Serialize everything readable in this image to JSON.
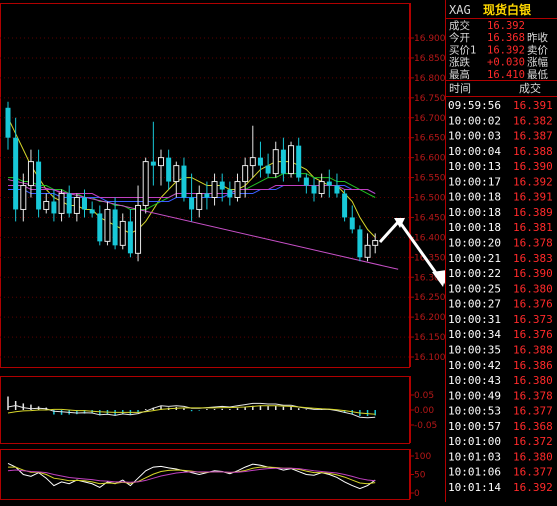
{
  "colors": {
    "background": "#000000",
    "frame": "#b00000",
    "grid": "#5a0000",
    "axis_text": "#b41818",
    "up": "#e6e6e6",
    "down": "#18c8d8",
    "ma_yellow": "#d6d62a",
    "ma_green": "#22c022",
    "ma_blue": "#3a5cff",
    "ma_magenta": "#c040c0",
    "trend": "#c850c8",
    "price_red": "#ff2a2a",
    "time_text": "#ffffff",
    "label_text": "#d8d8d8",
    "symbol_yellow": "#ffd800"
  },
  "header": {
    "symbol": "XAG",
    "name": "现货白银"
  },
  "quote": [
    {
      "label": "成交",
      "value": "16.392",
      "tail": ""
    },
    {
      "label": "今开",
      "value": "16.368",
      "tail": "昨收"
    },
    {
      "label": "买价1",
      "value": "16.392",
      "tail": "卖价"
    },
    {
      "label": "涨跌",
      "value": "+0.030",
      "tail": "涨幅"
    },
    {
      "label": "最高",
      "value": "16.410",
      "tail": "最低"
    }
  ],
  "ticks_header": {
    "time": "时间",
    "price": "成交"
  },
  "ticks": [
    {
      "time": "09:59:56",
      "price": "16.391"
    },
    {
      "time": "10:00:02",
      "price": "16.382"
    },
    {
      "time": "10:00:03",
      "price": "16.387"
    },
    {
      "time": "10:00:04",
      "price": "16.388"
    },
    {
      "time": "10:00:13",
      "price": "16.390"
    },
    {
      "time": "10:00:17",
      "price": "16.392"
    },
    {
      "time": "10:00:18",
      "price": "16.391"
    },
    {
      "time": "10:00:18",
      "price": "16.389"
    },
    {
      "time": "10:00:18",
      "price": "16.381"
    },
    {
      "time": "10:00:20",
      "price": "16.378"
    },
    {
      "time": "10:00:21",
      "price": "16.383"
    },
    {
      "time": "10:00:22",
      "price": "16.390"
    },
    {
      "time": "10:00:25",
      "price": "16.380"
    },
    {
      "time": "10:00:27",
      "price": "16.376"
    },
    {
      "time": "10:00:31",
      "price": "16.373"
    },
    {
      "time": "10:00:34",
      "price": "16.376"
    },
    {
      "time": "10:00:35",
      "price": "16.388"
    },
    {
      "time": "10:00:42",
      "price": "16.386"
    },
    {
      "time": "10:00:43",
      "price": "16.380"
    },
    {
      "time": "10:00:49",
      "price": "16.378"
    },
    {
      "time": "10:00:53",
      "price": "16.377"
    },
    {
      "time": "10:00:57",
      "price": "16.368"
    },
    {
      "time": "10:01:00",
      "price": "16.372"
    },
    {
      "time": "10:01:03",
      "price": "16.380"
    },
    {
      "time": "10:01:06",
      "price": "16.377"
    },
    {
      "time": "10:01:14",
      "price": "16.392"
    }
  ],
  "chart_data": [
    {
      "type": "candlestick",
      "ylim": [
        16.1,
        16.9
      ],
      "y_ticks": [
        "16.900",
        "16.850",
        "16.800",
        "16.750",
        "16.700",
        "16.650",
        "16.600",
        "16.550",
        "16.500",
        "16.450",
        "16.400",
        "16.350",
        "16.300",
        "16.250",
        "16.200",
        "16.150",
        "16.100"
      ],
      "grid": true,
      "candles": [
        {
          "o": 16.725,
          "h": 16.74,
          "l": 16.62,
          "c": 16.65
        },
        {
          "o": 16.65,
          "h": 16.7,
          "l": 16.44,
          "c": 16.47
        },
        {
          "o": 16.47,
          "h": 16.56,
          "l": 16.44,
          "c": 16.53
        },
        {
          "o": 16.53,
          "h": 16.62,
          "l": 16.5,
          "c": 16.59
        },
        {
          "o": 16.59,
          "h": 16.62,
          "l": 16.45,
          "c": 16.47
        },
        {
          "o": 16.47,
          "h": 16.51,
          "l": 16.46,
          "c": 16.49
        },
        {
          "o": 16.49,
          "h": 16.52,
          "l": 16.44,
          "c": 16.46
        },
        {
          "o": 16.46,
          "h": 16.52,
          "l": 16.44,
          "c": 16.51
        },
        {
          "o": 16.51,
          "h": 16.53,
          "l": 16.45,
          "c": 16.46
        },
        {
          "o": 16.46,
          "h": 16.51,
          "l": 16.44,
          "c": 16.5
        },
        {
          "o": 16.5,
          "h": 16.52,
          "l": 16.45,
          "c": 16.47
        },
        {
          "o": 16.47,
          "h": 16.49,
          "l": 16.45,
          "c": 16.46
        },
        {
          "o": 16.46,
          "h": 16.48,
          "l": 16.38,
          "c": 16.39
        },
        {
          "o": 16.39,
          "h": 16.49,
          "l": 16.38,
          "c": 16.47
        },
        {
          "o": 16.47,
          "h": 16.5,
          "l": 16.37,
          "c": 16.38
        },
        {
          "o": 16.38,
          "h": 16.46,
          "l": 16.37,
          "c": 16.44
        },
        {
          "o": 16.44,
          "h": 16.47,
          "l": 16.35,
          "c": 16.36
        },
        {
          "o": 16.36,
          "h": 16.53,
          "l": 16.34,
          "c": 16.48
        },
        {
          "o": 16.48,
          "h": 16.6,
          "l": 16.46,
          "c": 16.59
        },
        {
          "o": 16.59,
          "h": 16.69,
          "l": 16.53,
          "c": 16.58
        },
        {
          "o": 16.58,
          "h": 16.62,
          "l": 16.53,
          "c": 16.6
        },
        {
          "o": 16.6,
          "h": 16.62,
          "l": 16.52,
          "c": 16.54
        },
        {
          "o": 16.54,
          "h": 16.59,
          "l": 16.5,
          "c": 16.58
        },
        {
          "o": 16.58,
          "h": 16.6,
          "l": 16.49,
          "c": 16.5
        },
        {
          "o": 16.5,
          "h": 16.56,
          "l": 16.44,
          "c": 16.47
        },
        {
          "o": 16.47,
          "h": 16.53,
          "l": 16.45,
          "c": 16.51
        },
        {
          "o": 16.51,
          "h": 16.54,
          "l": 16.47,
          "c": 16.5
        },
        {
          "o": 16.5,
          "h": 16.56,
          "l": 16.48,
          "c": 16.54
        },
        {
          "o": 16.54,
          "h": 16.56,
          "l": 16.49,
          "c": 16.52
        },
        {
          "o": 16.52,
          "h": 16.54,
          "l": 16.48,
          "c": 16.5
        },
        {
          "o": 16.5,
          "h": 16.56,
          "l": 16.49,
          "c": 16.54
        },
        {
          "o": 16.54,
          "h": 16.6,
          "l": 16.5,
          "c": 16.58
        },
        {
          "o": 16.58,
          "h": 16.68,
          "l": 16.55,
          "c": 16.6
        },
        {
          "o": 16.6,
          "h": 16.64,
          "l": 16.55,
          "c": 16.58
        },
        {
          "o": 16.58,
          "h": 16.61,
          "l": 16.55,
          "c": 16.56
        },
        {
          "o": 16.56,
          "h": 16.64,
          "l": 16.55,
          "c": 16.62
        },
        {
          "o": 16.62,
          "h": 16.65,
          "l": 16.54,
          "c": 16.56
        },
        {
          "o": 16.56,
          "h": 16.64,
          "l": 16.55,
          "c": 16.63
        },
        {
          "o": 16.63,
          "h": 16.65,
          "l": 16.54,
          "c": 16.55
        },
        {
          "o": 16.55,
          "h": 16.56,
          "l": 16.51,
          "c": 16.53
        },
        {
          "o": 16.53,
          "h": 16.55,
          "l": 16.49,
          "c": 16.51
        },
        {
          "o": 16.51,
          "h": 16.56,
          "l": 16.5,
          "c": 16.54
        },
        {
          "o": 16.54,
          "h": 16.57,
          "l": 16.5,
          "c": 16.53
        },
        {
          "o": 16.53,
          "h": 16.56,
          "l": 16.5,
          "c": 16.51
        },
        {
          "o": 16.51,
          "h": 16.52,
          "l": 16.44,
          "c": 16.45
        },
        {
          "o": 16.45,
          "h": 16.48,
          "l": 16.41,
          "c": 16.42
        },
        {
          "o": 16.42,
          "h": 16.43,
          "l": 16.34,
          "c": 16.35
        },
        {
          "o": 16.35,
          "h": 16.41,
          "l": 16.34,
          "c": 16.38
        },
        {
          "o": 16.38,
          "h": 16.41,
          "l": 16.36,
          "c": 16.392
        }
      ],
      "series": [
        {
          "color": "#d6d62a",
          "values": [
            16.7,
            16.66,
            16.62,
            16.58,
            16.55,
            16.52,
            16.5,
            16.49,
            16.48,
            16.48,
            16.47,
            16.47,
            16.45,
            16.44,
            16.43,
            16.42,
            16.41,
            16.42,
            16.44,
            16.47,
            16.5,
            16.52,
            16.54,
            16.55,
            16.55,
            16.54,
            16.53,
            16.53,
            16.53,
            16.52,
            16.52,
            16.53,
            16.55,
            16.57,
            16.58,
            16.59,
            16.59,
            16.59,
            16.58,
            16.57,
            16.55,
            16.54,
            16.53,
            16.53,
            16.51,
            16.49,
            16.45,
            16.42,
            16.4
          ]
        },
        {
          "color": "#22c022",
          "values": [
            16.55,
            16.55,
            16.54,
            16.54,
            16.53,
            16.53,
            16.52,
            16.52,
            16.51,
            16.51,
            16.5,
            16.5,
            16.49,
            16.49,
            16.48,
            16.48,
            16.47,
            16.47,
            16.47,
            16.48,
            16.49,
            16.5,
            16.51,
            16.51,
            16.51,
            16.51,
            16.51,
            16.51,
            16.51,
            16.51,
            16.52,
            16.52,
            16.53,
            16.54,
            16.55,
            16.55,
            16.56,
            16.56,
            16.56,
            16.56,
            16.55,
            16.55,
            16.55,
            16.54,
            16.54,
            16.53,
            16.52,
            16.51,
            16.5
          ]
        },
        {
          "color": "#3a5cff",
          "values": [
            16.52,
            16.52,
            16.52,
            16.51,
            16.51,
            16.51,
            16.51,
            16.5,
            16.5,
            16.5,
            16.5,
            16.5,
            16.5,
            16.49,
            16.49,
            16.49,
            16.49,
            16.49,
            16.49,
            16.49,
            16.49,
            16.49,
            16.5,
            16.5,
            16.5,
            16.5,
            16.5,
            16.5,
            16.5,
            16.51,
            16.51,
            16.51,
            16.51,
            16.52,
            16.52,
            16.52,
            16.53,
            16.53,
            16.53,
            16.53,
            16.53,
            16.53,
            16.53,
            16.53,
            16.53,
            16.52,
            16.52,
            16.52,
            16.51
          ]
        },
        {
          "color": "#c040c0",
          "values": [
            16.53,
            16.53,
            16.53,
            16.52,
            16.52,
            16.52,
            16.52,
            16.51,
            16.51,
            16.51,
            16.51,
            16.51,
            16.5,
            16.5,
            16.5,
            16.5,
            16.5,
            16.5,
            16.5,
            16.5,
            16.5,
            16.5,
            16.51,
            16.51,
            16.51,
            16.51,
            16.51,
            16.51,
            16.51,
            16.51,
            16.52,
            16.52,
            16.52,
            16.52,
            16.52,
            16.53,
            16.53,
            16.53,
            16.53,
            16.53,
            16.53,
            16.53,
            16.53,
            16.53,
            16.52,
            16.52,
            16.52,
            16.52,
            16.51
          ]
        }
      ],
      "trendline": {
        "from_index": 0,
        "from_value": 16.545,
        "to_index": 51,
        "to_value": 16.32
      }
    },
    {
      "type": "bar",
      "ylim": [
        -0.07,
        0.07
      ],
      "y_ticks": [
        "0.05",
        "0.00",
        "-0.05"
      ],
      "values": [
        0.045,
        0.03,
        0.022,
        0.018,
        0.012,
        0.008,
        -0.015,
        -0.016,
        -0.015,
        -0.014,
        -0.012,
        -0.01,
        -0.018,
        -0.015,
        -0.019,
        -0.013,
        -0.017,
        -0.01,
        0.003,
        0.008,
        0.012,
        0.008,
        0.01,
        0.006,
        -0.004,
        -0.002,
        0.003,
        0.003,
        0.004,
        0.003,
        0.006,
        0.01,
        0.014,
        0.015,
        0.013,
        0.014,
        0.011,
        0.012,
        0.006,
        0.002,
        0.0,
        0.002,
        0.002,
        -0.003,
        -0.01,
        -0.014,
        -0.02,
        -0.02,
        -0.018
      ],
      "series": [
        {
          "color": "#e6e6e6",
          "values": [
            0.01,
            0.015,
            0.008,
            0.004,
            0.006,
            0.004,
            -0.004,
            -0.006,
            -0.008,
            -0.01,
            -0.009,
            -0.01,
            -0.016,
            -0.014,
            -0.018,
            -0.013,
            -0.016,
            -0.012,
            -0.004,
            0.006,
            0.014,
            0.012,
            0.014,
            0.012,
            0.006,
            0.006,
            0.008,
            0.01,
            0.012,
            0.01,
            0.014,
            0.018,
            0.022,
            0.022,
            0.02,
            0.02,
            0.016,
            0.016,
            0.01,
            0.006,
            0.002,
            0.002,
            0.002,
            -0.002,
            -0.008,
            -0.014,
            -0.024,
            -0.026,
            -0.024
          ]
        },
        {
          "color": "#d6d62a",
          "values": [
            -0.01,
            -0.006,
            -0.003,
            -0.002,
            0.0,
            0.0,
            0.002,
            0.002,
            0.0,
            -0.002,
            -0.002,
            -0.004,
            -0.006,
            -0.007,
            -0.008,
            -0.008,
            -0.008,
            -0.008,
            -0.006,
            -0.002,
            0.002,
            0.004,
            0.006,
            0.007,
            0.007,
            0.007,
            0.007,
            0.007,
            0.008,
            0.008,
            0.009,
            0.01,
            0.012,
            0.014,
            0.014,
            0.014,
            0.013,
            0.012,
            0.01,
            0.008,
            0.006,
            0.004,
            0.003,
            0.001,
            -0.002,
            -0.006,
            -0.01,
            -0.012,
            -0.014
          ]
        }
      ]
    },
    {
      "type": "line",
      "ylim": [
        0,
        100
      ],
      "y_ticks": [
        "100",
        "50",
        "0"
      ],
      "series": [
        {
          "color": "#ffffff",
          "values": [
            80,
            70,
            50,
            45,
            55,
            40,
            20,
            30,
            25,
            35,
            30,
            25,
            15,
            30,
            25,
            35,
            20,
            40,
            60,
            70,
            72,
            68,
            65,
            60,
            55,
            50,
            55,
            60,
            58,
            52,
            60,
            70,
            78,
            75,
            70,
            68,
            62,
            66,
            58,
            50,
            48,
            55,
            50,
            42,
            30,
            20,
            12,
            20,
            35
          ]
        },
        {
          "color": "#d6d62a",
          "values": [
            70,
            70,
            62,
            56,
            56,
            50,
            40,
            37,
            33,
            34,
            33,
            30,
            25,
            27,
            26,
            29,
            26,
            31,
            41,
            51,
            58,
            61,
            62,
            61,
            59,
            56,
            56,
            57,
            57,
            55,
            57,
            61,
            67,
            70,
            70,
            69,
            67,
            67,
            64,
            59,
            55,
            55,
            53,
            49,
            43,
            35,
            27,
            25,
            28
          ]
        },
        {
          "color": "#c040c0",
          "values": [
            60,
            62,
            60,
            58,
            57,
            55,
            50,
            46,
            42,
            40,
            38,
            36,
            33,
            32,
            30,
            30,
            29,
            30,
            34,
            40,
            46,
            50,
            54,
            56,
            57,
            57,
            57,
            57,
            57,
            56,
            56,
            58,
            61,
            64,
            66,
            67,
            67,
            67,
            66,
            63,
            60,
            58,
            56,
            54,
            50,
            45,
            39,
            35,
            33
          ]
        }
      ]
    }
  ]
}
